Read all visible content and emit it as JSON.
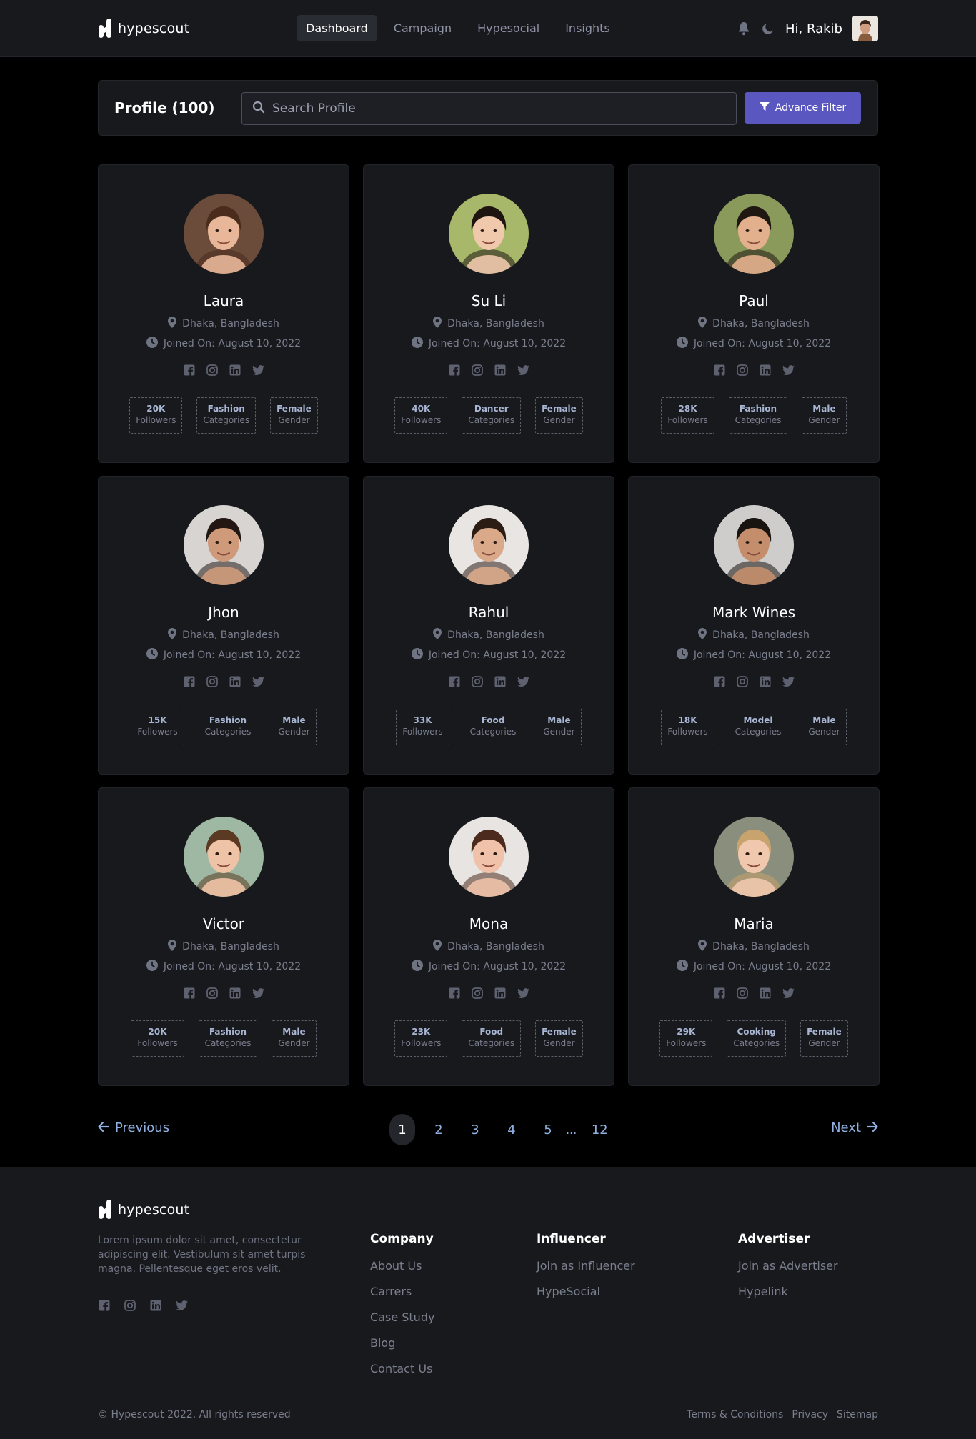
{
  "header": {
    "brand": "hypescout",
    "nav": [
      {
        "label": "Dashboard",
        "active": true
      },
      {
        "label": "Campaign",
        "active": false
      },
      {
        "label": "Hypesocial",
        "active": false
      },
      {
        "label": "Insights",
        "active": false
      }
    ],
    "greeting": "Hi, Rakib",
    "icons": [
      "bell-icon",
      "moon-icon"
    ]
  },
  "search": {
    "title": "Profile (100)",
    "placeholder": "Search Profile",
    "filter_label": "Advance Filter"
  },
  "profiles": [
    {
      "name": "Laura",
      "location": "Dhaka, Bangladesh",
      "joined": "Joined On: August 10, 2022",
      "followers": "20K",
      "followers_label": "Followers",
      "category": "Fashion",
      "category_label": "Categories",
      "gender": "Female",
      "gender_label": "Gender",
      "avatar": {
        "bg": "#6b4b3a",
        "skin": "#e8b79a",
        "hair": "#4a2c1d"
      }
    },
    {
      "name": "Su Li",
      "location": "Dhaka, Bangladesh",
      "joined": "Joined On: August 10, 2022",
      "followers": "40K",
      "followers_label": "Followers",
      "category": "Dancer",
      "category_label": "Categories",
      "gender": "Female",
      "gender_label": "Gender",
      "avatar": {
        "bg": "#a8b86a",
        "skin": "#f0c9ad",
        "hair": "#1e1410"
      }
    },
    {
      "name": "Paul",
      "location": "Dhaka, Bangladesh",
      "joined": "Joined On: August 10, 2022",
      "followers": "28K",
      "followers_label": "Followers",
      "category": "Fashion",
      "category_label": "Categories",
      "gender": "Male",
      "gender_label": "Gender",
      "avatar": {
        "bg": "#8a9a5a",
        "skin": "#e3b08e",
        "hair": "#1f1712"
      }
    },
    {
      "name": "Jhon",
      "location": "Dhaka, Bangladesh",
      "joined": "Joined On: August 10, 2022",
      "followers": "15K",
      "followers_label": "Followers",
      "category": "Fashion",
      "category_label": "Categories",
      "gender": "Male",
      "gender_label": "Gender",
      "avatar": {
        "bg": "#d7d4d2",
        "skin": "#cf9a7a",
        "hair": "#221713"
      }
    },
    {
      "name": "Rahul",
      "location": "Dhaka, Bangladesh",
      "joined": "Joined On: August 10, 2022",
      "followers": "33K",
      "followers_label": "Followers",
      "category": "Food",
      "category_label": "Categories",
      "gender": "Male",
      "gender_label": "Gender",
      "avatar": {
        "bg": "#e9e5e2",
        "skin": "#d9a98a",
        "hair": "#2b1c14"
      }
    },
    {
      "name": "Mark Wines",
      "location": "Dhaka, Bangladesh",
      "joined": "Joined On: August 10, 2022",
      "followers": "18K",
      "followers_label": "Followers",
      "category": "Model",
      "category_label": "Categories",
      "gender": "Male",
      "gender_label": "Gender",
      "avatar": {
        "bg": "#cfcdcb",
        "skin": "#c48e6c",
        "hair": "#1a1411"
      }
    },
    {
      "name": "Victor",
      "location": "Dhaka, Bangladesh",
      "joined": "Joined On: August 10, 2022",
      "followers": "20K",
      "followers_label": "Followers",
      "category": "Fashion",
      "category_label": "Categories",
      "gender": "Male",
      "gender_label": "Gender",
      "avatar": {
        "bg": "#9fb8a3",
        "skin": "#efc3a6",
        "hair": "#5a3a23"
      }
    },
    {
      "name": "Mona",
      "location": "Dhaka, Bangladesh",
      "joined": "Joined On: August 10, 2022",
      "followers": "23K",
      "followers_label": "Followers",
      "category": "Food",
      "category_label": "Categories",
      "gender": "Female",
      "gender_label": "Gender",
      "avatar": {
        "bg": "#e8e4e1",
        "skin": "#efc2a9",
        "hair": "#4c2b1e"
      }
    },
    {
      "name": "Maria",
      "location": "Dhaka, Bangladesh",
      "joined": "Joined On: August 10, 2022",
      "followers": "29K",
      "followers_label": "Followers",
      "category": "Cooking",
      "category_label": "Categories",
      "gender": "Female",
      "gender_label": "Gender",
      "avatar": {
        "bg": "#8a8f7d",
        "skin": "#f0c8ad",
        "hair": "#c9a36e"
      }
    }
  ],
  "pagination": {
    "prev": "Previous",
    "next": "Next",
    "pages": [
      "1",
      "2",
      "3",
      "4",
      "5"
    ],
    "ellipsis": "...",
    "last": "12",
    "current": "1"
  },
  "footer": {
    "brand": "hypescout",
    "description": "Lorem ipsum dolor sit amet, consectetur adipiscing elit. Vestibulum sit amet turpis magna. Pellentesque eget eros velit.",
    "columns": [
      {
        "title": "Company",
        "links": [
          "About Us",
          "Carrers",
          "Case Study",
          "Blog",
          "Contact Us"
        ]
      },
      {
        "title": "Influencer",
        "links": [
          "Join as Influencer",
          "HypeSocial"
        ]
      },
      {
        "title": "Advertiser",
        "links": [
          "Join as Advertiser",
          "Hypelink"
        ]
      }
    ],
    "copyright": "© Hypescout 2022. All rights reserved",
    "legal": [
      "Terms & Conditions",
      "Privacy",
      "Sitemap"
    ]
  },
  "colors": {
    "accent": "#5b57c0",
    "card_bg": "#18191d",
    "page_bg": "#000000",
    "link": "#8fb0e0"
  }
}
